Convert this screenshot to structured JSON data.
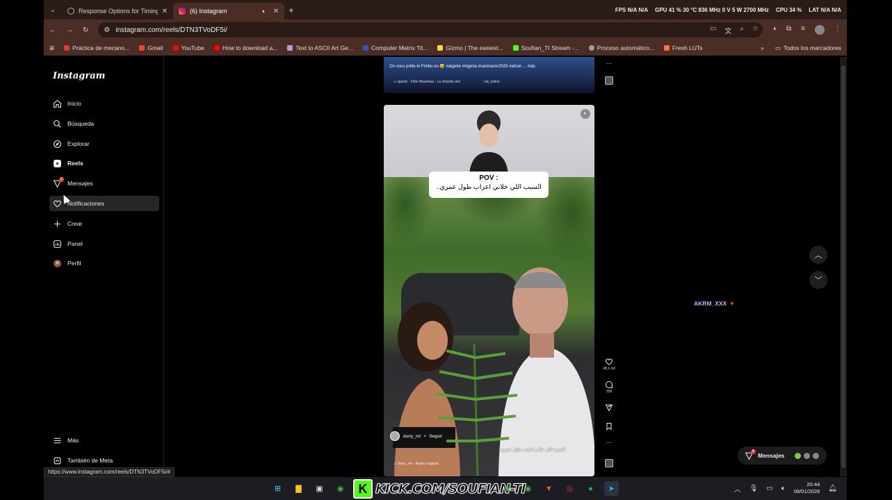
{
  "browser": {
    "tabs": [
      {
        "title": "Response Options for Timing",
        "active": false
      },
      {
        "title": "(6) Instagram",
        "active": true
      }
    ],
    "stats": [
      "FPS",
      "N/A",
      "N/A",
      "GPU",
      "41 %",
      "30 °C",
      "836 MHz",
      "0 V",
      "5 W",
      "2700 MHz",
      "CPU",
      "34 %",
      "LAT",
      "N/A",
      "N/A"
    ],
    "url": "instagram.com/reels/DTN3TVoDF5i/",
    "bookmarks": [
      "Práctica de mecano...",
      "Gmail",
      "YouTube",
      "How to download a...",
      "Text to ASCII Art Ge...",
      "Computer Matrix Tit...",
      "Gizmo | The easiest...",
      "Soufian_TI Stream -...",
      "Proceso automático...",
      "Fresh LUTs"
    ],
    "all_bookmarks": "Todos los marcadores",
    "status_url": "https://www.instagram.com/reels/DTN3TVoDF5i/#"
  },
  "instagram": {
    "logo": "Instagram",
    "nav": [
      {
        "label": "Inicio",
        "icon": "home-icon"
      },
      {
        "label": "Búsqueda",
        "icon": "search-icon"
      },
      {
        "label": "Explorar",
        "icon": "compass-icon"
      },
      {
        "label": "Reels",
        "icon": "reels-icon"
      },
      {
        "label": "Mensajes",
        "icon": "messenger-icon"
      },
      {
        "label": "Notificaciones",
        "icon": "heart-icon"
      },
      {
        "label": "Crear",
        "icon": "plus-icon"
      },
      {
        "label": "Panel",
        "icon": "dashboard-icon"
      },
      {
        "label": "Perfil",
        "icon": "avatar-icon"
      }
    ],
    "more": "Más",
    "meta": "También de Meta",
    "prev_reel": {
      "caption": "On vous prête le Fimbu ou 😅 #algerie #nigeria #canmaroc2025 #afcon ... más",
      "music": "♫ spards · Félix Wazekwa · La chicotte des",
      "tag": "caf_online"
    },
    "reel": {
      "pov_title": "POV :",
      "pov_text": "السبب اللي خلاني اعزاب طول عمري..",
      "username": "duny_rol",
      "follow": "Seguir",
      "subtitle": "السبب اللي خلاني اعزاب طول عمري..",
      "audio": "♫ duny_rol · Audio original",
      "likes": "48,1 mil",
      "comments": "258"
    },
    "suggested_user": "AKRM_XXX",
    "messages_pill": "Mensajes",
    "message_badge": "6"
  },
  "taskbar": {
    "kick_text": "KICK.COM/SOUFIAN-TI",
    "time": "20:44",
    "date": "08/01/2026"
  }
}
